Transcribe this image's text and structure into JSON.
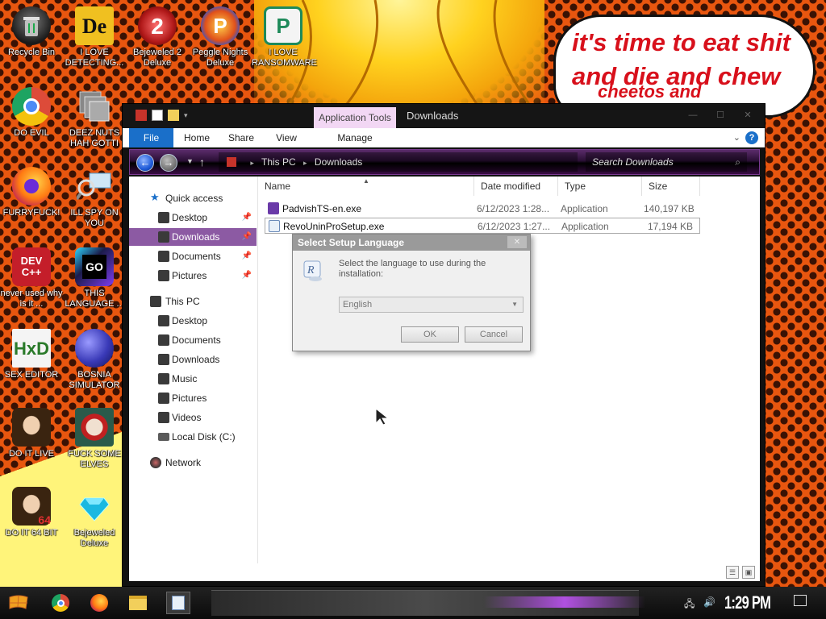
{
  "wallpaper": {
    "bubble_line1": "it's time to eat shit",
    "bubble_line2": "and die and chew",
    "bubble_line3": "cheetos and"
  },
  "desktop_icons": [
    {
      "label": "Recycle Bin",
      "icon": "recycle-bin-icon",
      "color": "#2b2b2b"
    },
    {
      "label": "I LOVE DETECTING...",
      "icon": "detect-it-easy-icon",
      "color": "#f0c020"
    },
    {
      "label": "Bejeweled 2 Deluxe",
      "icon": "bejeweled-2-icon",
      "color": "#c02a2a"
    },
    {
      "label": "Peggle Nights Deluxe",
      "icon": "peggle-icon",
      "color": "#e0501a"
    },
    {
      "label": "I LOVE RANSOMWARE",
      "icon": "publisher-icon",
      "color": "#1e8a5a"
    },
    {
      "label": "DO EVIL",
      "icon": "chrome-icon",
      "color": "#dd4b39"
    },
    {
      "label": "DEEZ NUTS HAH GOTTI",
      "icon": "copy-icon",
      "color": "#777777"
    },
    {
      "label": "FURRYFUCK!",
      "icon": "firefox-icon",
      "color": "#ff7a12"
    },
    {
      "label": "ILL SPY ON YOU",
      "icon": "spy-icon",
      "color": "#5aa0d0"
    },
    {
      "label": "never used why is it ...",
      "icon": "dev-cpp-icon",
      "color": "#c41e2a"
    },
    {
      "label": "THIS LANGUAGE ...",
      "icon": "goland-icon",
      "color": "#1b1b4a"
    },
    {
      "label": "SEX EDITOR",
      "icon": "hxd-icon",
      "color": "#f4f4f4"
    },
    {
      "label": "BOSNIA SIMULATOR",
      "icon": "mine-icon",
      "color": "#3a3ab8"
    },
    {
      "label": "DO IT LIVE",
      "icon": "portrait-icon",
      "color": "#6b4a30"
    },
    {
      "label": "FUCK SOME ELVES",
      "icon": "elf-icon",
      "color": "#4a7a3a"
    },
    {
      "label": "DO IT 64 BIT",
      "icon": "portrait-64-icon",
      "color": "#6b4a30"
    },
    {
      "label": "Bejeweled Deluxe",
      "icon": "diamond-icon",
      "color": "#1ab8e0"
    }
  ],
  "explorer": {
    "title": "Downloads",
    "context_tab": "Application Tools",
    "tabs": {
      "file": "File",
      "home": "Home",
      "share": "Share",
      "view": "View",
      "manage": "Manage"
    },
    "address": {
      "root": "This PC",
      "folder": "Downloads"
    },
    "search_placeholder": "Search Downloads",
    "nav": {
      "quick_access": "Quick access",
      "qa_desktop": "Desktop",
      "qa_downloads": "Downloads",
      "qa_documents": "Documents",
      "qa_pictures": "Pictures",
      "this_pc": "This PC",
      "pc_desktop": "Desktop",
      "pc_documents": "Documents",
      "pc_downloads": "Downloads",
      "pc_music": "Music",
      "pc_pictures": "Pictures",
      "pc_videos": "Videos",
      "pc_local_disk": "Local Disk (C:)",
      "network": "Network"
    },
    "columns": {
      "name": "Name",
      "date": "Date modified",
      "type": "Type",
      "size": "Size"
    },
    "files": [
      {
        "name": "PadvishTS-en.exe",
        "date": "6/12/2023 1:28...",
        "type": "Application",
        "size": "140,197 KB"
      },
      {
        "name": "RevoUninProSetup.exe",
        "date": "6/12/2023 1:27...",
        "type": "Application",
        "size": "17,194 KB"
      }
    ]
  },
  "dialog": {
    "title": "Select Setup Language",
    "message": "Select the language to use during the installation:",
    "selected_language": "English",
    "ok": "OK",
    "cancel": "Cancel"
  },
  "taskbar": {
    "clock": "1:29 PM"
  },
  "colors": {
    "accent_blue": "#1a6fc9",
    "selection_purple": "#8c5aa3",
    "bubble_text_red": "#d8101b"
  }
}
